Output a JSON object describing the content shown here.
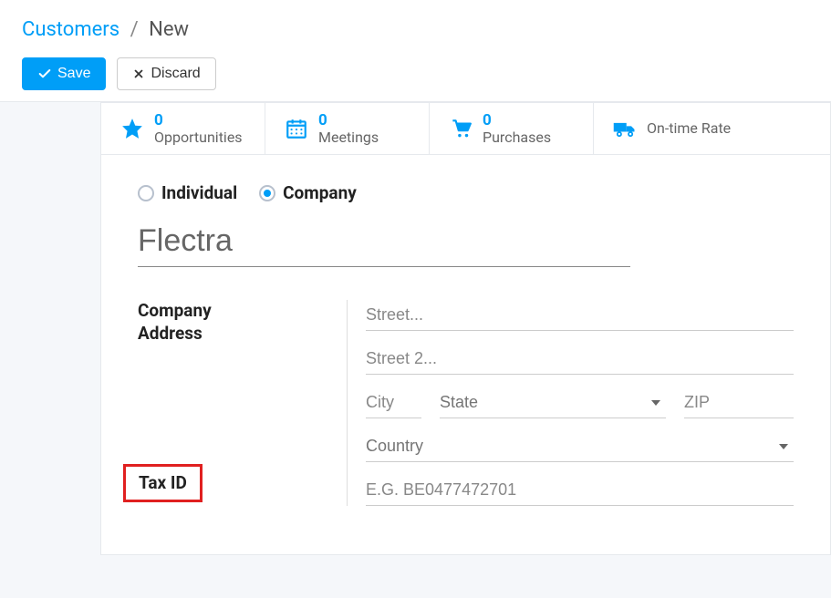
{
  "breadcrumb": {
    "root": "Customers",
    "sep": "/",
    "current": "New"
  },
  "actions": {
    "save": "Save",
    "discard": "Discard"
  },
  "stats": {
    "opportunities": {
      "count": "0",
      "label": "Opportunities"
    },
    "meetings": {
      "count": "0",
      "label": "Meetings"
    },
    "purchases": {
      "count": "0",
      "label": "Purchases"
    },
    "ontime": {
      "label": "On-time Rate"
    }
  },
  "type_options": {
    "individual": "Individual",
    "company": "Company",
    "selected": "company"
  },
  "name_value": "Flectra",
  "labels": {
    "company_address_l1": "Company",
    "company_address_l2": "Address",
    "tax_id": "Tax ID"
  },
  "placeholders": {
    "street": "Street...",
    "street2": "Street 2...",
    "city": "City",
    "state": "State",
    "zip": "ZIP",
    "country": "Country",
    "taxid": "E.G. BE0477472701"
  }
}
